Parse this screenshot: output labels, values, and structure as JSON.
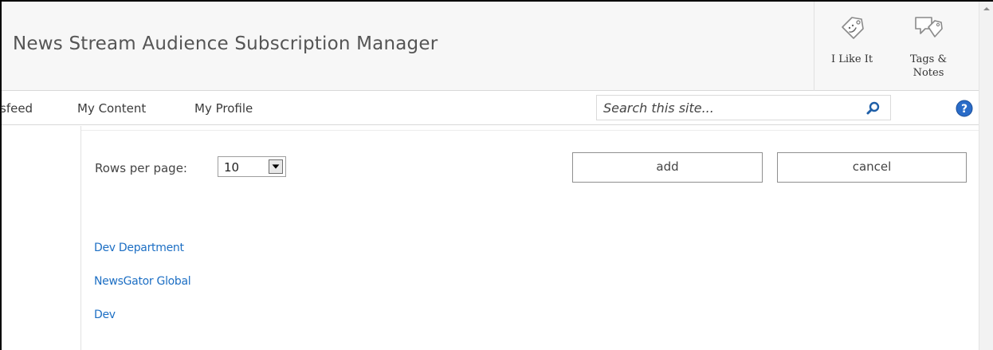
{
  "header": {
    "site_title": "News Stream Audience Subscription Manager",
    "social": [
      {
        "label": "I Like It",
        "icon": "i-like-it-tag-icon"
      },
      {
        "label": "Tags &\nNotes",
        "icon": "tags-notes-icon"
      }
    ]
  },
  "nav": {
    "items": [
      "sfeed",
      "My Content",
      "My Profile"
    ],
    "search_placeholder": "Search this site...",
    "search_icon": "magnifier-icon",
    "help_icon": "help-question-icon"
  },
  "controls": {
    "rows_label": "Rows per page:",
    "rows_value": "10",
    "add_label": "add",
    "cancel_label": "cancel"
  },
  "list": {
    "items": [
      "Dev Department",
      "NewsGator Global",
      "Dev"
    ]
  },
  "colors": {
    "link": "#1d6fc4",
    "help_blue": "#2a6cc8",
    "header_bg": "#f7f7f7"
  }
}
